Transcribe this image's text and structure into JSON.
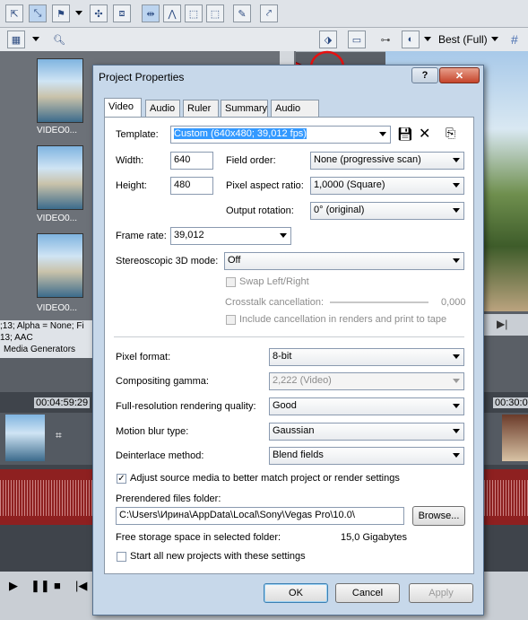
{
  "app": {
    "preview_quality": "Best (Full)",
    "media_labels": [
      "VIDEO0...",
      "VIDEO0...",
      "VIDEO0..."
    ],
    "status_line1": ";13; Alpha = None; Fi",
    "status_line2": "13; AAC",
    "media_generators_tab": "Media Generators",
    "time_marker_1": "00:04:59:29",
    "time_marker_2": "00:30:0"
  },
  "dialog": {
    "title": "Project Properties",
    "help_button": "?",
    "close_button": "✕",
    "tabs": [
      "Video",
      "Audio",
      "Ruler",
      "Summary",
      "Audio CD"
    ],
    "active_tab": "Video",
    "template_label": "Template:",
    "template_value": "Custom (640x480; 39,012 fps)",
    "width_label": "Width:",
    "width_value": "640",
    "height_label": "Height:",
    "height_value": "480",
    "field_order_label": "Field order:",
    "field_order_value": "None (progressive scan)",
    "pixel_aspect_label": "Pixel aspect ratio:",
    "pixel_aspect_value": "1,0000 (Square)",
    "output_rotation_label": "Output rotation:",
    "output_rotation_value": "0° (original)",
    "frame_rate_label": "Frame rate:",
    "frame_rate_value": "39,012",
    "stereo_label": "Stereoscopic 3D mode:",
    "stereo_value": "Off",
    "swap_label": "Swap Left/Right",
    "crosstalk_label": "Crosstalk cancellation:",
    "crosstalk_value": "0,000",
    "include_cancel_label": "Include cancellation in renders and print to tape",
    "pixel_format_label": "Pixel format:",
    "pixel_format_value": "8-bit",
    "compositing_gamma_label": "Compositing gamma:",
    "compositing_gamma_value": "2,222 (Video)",
    "render_quality_label": "Full-resolution rendering quality:",
    "render_quality_value": "Good",
    "motion_blur_label": "Motion blur type:",
    "motion_blur_value": "Gaussian",
    "deinterlace_label": "Deinterlace method:",
    "deinterlace_value": "Blend fields",
    "adjust_source_label": "Adjust source media to better match project or render settings",
    "adjust_source_checked": true,
    "prerendered_label": "Prerendered files folder:",
    "prerendered_value": "C:\\Users\\Ирина\\AppData\\Local\\Sony\\Vegas Pro\\10.0\\",
    "browse_button": "Browse...",
    "free_storage_label": "Free storage space in selected folder:",
    "free_storage_value": "15,0 Gigabytes",
    "start_all_label": "Start all new projects with these settings",
    "ok_button": "OK",
    "cancel_button": "Cancel",
    "apply_button": "Apply"
  },
  "colors": {
    "annotation_arrow": "#e81010",
    "dialog_frame": "#c7d8ea",
    "waveform_track": "#8e2020"
  }
}
